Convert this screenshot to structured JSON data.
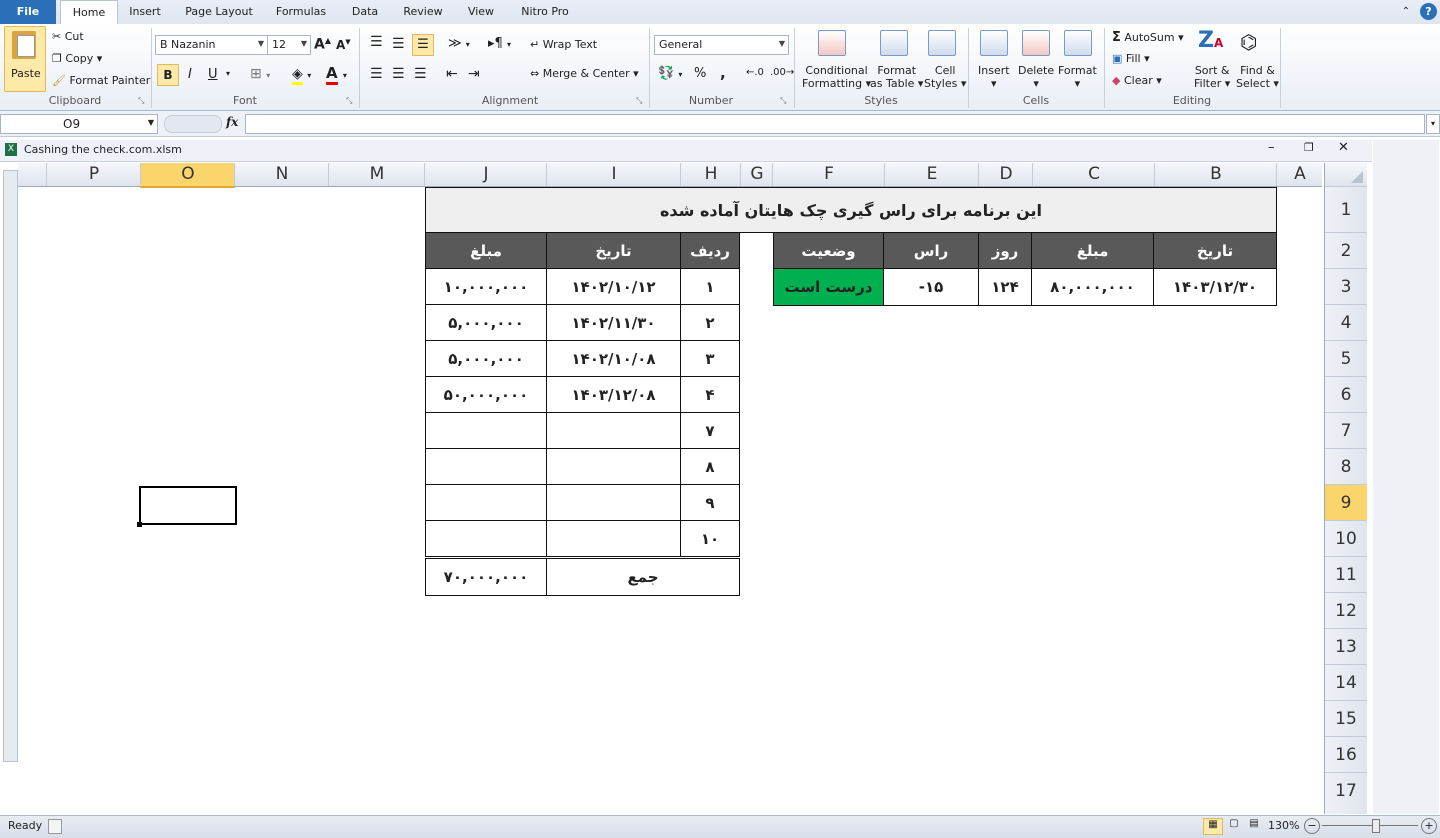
{
  "tabs": [
    "File",
    "Home",
    "Insert",
    "Page Layout",
    "Formulas",
    "Data",
    "Review",
    "View",
    "Nitro Pro"
  ],
  "clipboard": {
    "paste": "Paste",
    "cut": "Cut",
    "copy": "Copy",
    "format_painter": "Format Painter",
    "label": "Clipboard"
  },
  "font": {
    "name": "B Nazanin",
    "size": "12",
    "bold": "B",
    "italic": "I",
    "underline": "U",
    "label": "Font"
  },
  "alignment": {
    "wrap": "Wrap Text",
    "merge": "Merge & Center",
    "label": "Alignment"
  },
  "number": {
    "format": "General",
    "percent": "%",
    "comma": ",",
    "label": "Number"
  },
  "styles": {
    "conditional_1": "Conditional",
    "conditional_2": "Formatting",
    "format_table_1": "Format",
    "format_table_2": "as Table",
    "cell_styles_1": "Cell",
    "cell_styles_2": "Styles",
    "label": "Styles"
  },
  "cells": {
    "insert": "Insert",
    "delete": "Delete",
    "format": "Format",
    "label": "Cells"
  },
  "editing": {
    "autosum": "AutoSum",
    "fill": "Fill",
    "clear": "Clear",
    "sort_1": "Sort &",
    "sort_2": "Filter",
    "find_1": "Find &",
    "find_2": "Select",
    "label": "Editing"
  },
  "formula_bar": {
    "name_box": "O9",
    "fx": "fx",
    "value": ""
  },
  "workbook_title": "Cashing the check.com.xlsm",
  "columns": [
    "P",
    "O",
    "N",
    "M",
    "J",
    "I",
    "H",
    "G",
    "F",
    "E",
    "D",
    "C",
    "B",
    "A"
  ],
  "rows": [
    "1",
    "2",
    "3",
    "4",
    "5",
    "6",
    "7",
    "8",
    "9",
    "10",
    "11",
    "12",
    "13",
    "14",
    "15",
    "16",
    "17"
  ],
  "sheet": {
    "title": "این برنامه برای راس گیری چک هایتان آماده شده",
    "summary_headers": [
      "تاریخ",
      "مبلغ",
      "روز",
      "راس",
      "وضعیت"
    ],
    "summary_values": [
      "۱۴۰۳/۱۲/۳۰",
      "۸۰,۰۰۰,۰۰۰",
      "۱۲۴",
      "-۱۵",
      "درست است"
    ],
    "list_headers": [
      "ردیف",
      "تاریخ",
      "مبلغ"
    ],
    "list_rows": [
      [
        "۱",
        "۱۴۰۲/۱۰/۱۲",
        "۱۰,۰۰۰,۰۰۰"
      ],
      [
        "۲",
        "۱۴۰۲/۱۱/۳۰",
        "۵,۰۰۰,۰۰۰"
      ],
      [
        "۳",
        "۱۴۰۲/۱۰/۰۸",
        "۵,۰۰۰,۰۰۰"
      ],
      [
        "۴",
        "۱۴۰۳/۱۲/۰۸",
        "۵۰,۰۰۰,۰۰۰"
      ],
      [
        "۷",
        "",
        ""
      ],
      [
        "۸",
        "",
        ""
      ],
      [
        "۹",
        "",
        ""
      ],
      [
        "۱۰",
        "",
        ""
      ]
    ],
    "total_label": "جمع",
    "total_value": "۷۰,۰۰۰,۰۰۰"
  },
  "status": {
    "ready": "Ready",
    "zoom": "130%"
  },
  "colors": {
    "header_fill": "#595959",
    "status_ok": "#00b050",
    "selected_header": "#f9d56b"
  }
}
